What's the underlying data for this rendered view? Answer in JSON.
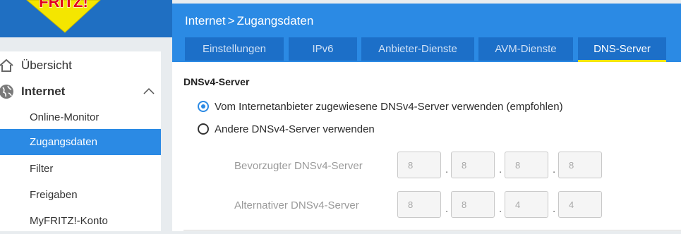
{
  "brand": {
    "logo_text": "FRITZ!",
    "colors": {
      "brand_blue": "#2b8ae4",
      "dark_blue": "#1c6fc8",
      "accent_yellow": "#f4e600",
      "logo_red": "#e2001a"
    }
  },
  "sidebar": {
    "items": [
      {
        "label": "Übersicht",
        "icon": "home-icon"
      },
      {
        "label": "Internet",
        "icon": "globe-icon",
        "expanded": true,
        "children": [
          {
            "label": "Online-Monitor"
          },
          {
            "label": "Zugangsdaten",
            "active": true
          },
          {
            "label": "Filter"
          },
          {
            "label": "Freigaben"
          },
          {
            "label": "MyFRITZ!-Konto"
          }
        ]
      }
    ]
  },
  "header": {
    "breadcrumb": {
      "section": "Internet",
      "separator": ">",
      "page": "Zugangsdaten"
    },
    "tabs": [
      {
        "label": "Einstellungen"
      },
      {
        "label": "IPv6"
      },
      {
        "label": "Anbieter-Dienste"
      },
      {
        "label": "AVM-Dienste"
      },
      {
        "label": "DNS-Server",
        "active": true
      }
    ]
  },
  "dns": {
    "title": "DNSv4-Server",
    "options": [
      {
        "label": "Vom Internetanbieter zugewiesene DNSv4-Server verwenden (empfohlen)",
        "checked": true
      },
      {
        "label": "Andere DNSv4-Server verwenden",
        "checked": false
      }
    ],
    "preferred": {
      "label": "Bevorzugter DNSv4-Server",
      "octets": [
        "8",
        "8",
        "8",
        "8"
      ]
    },
    "alternative": {
      "label": "Alternativer DNSv4-Server",
      "octets": [
        "8",
        "8",
        "4",
        "4"
      ]
    },
    "separator": "."
  }
}
